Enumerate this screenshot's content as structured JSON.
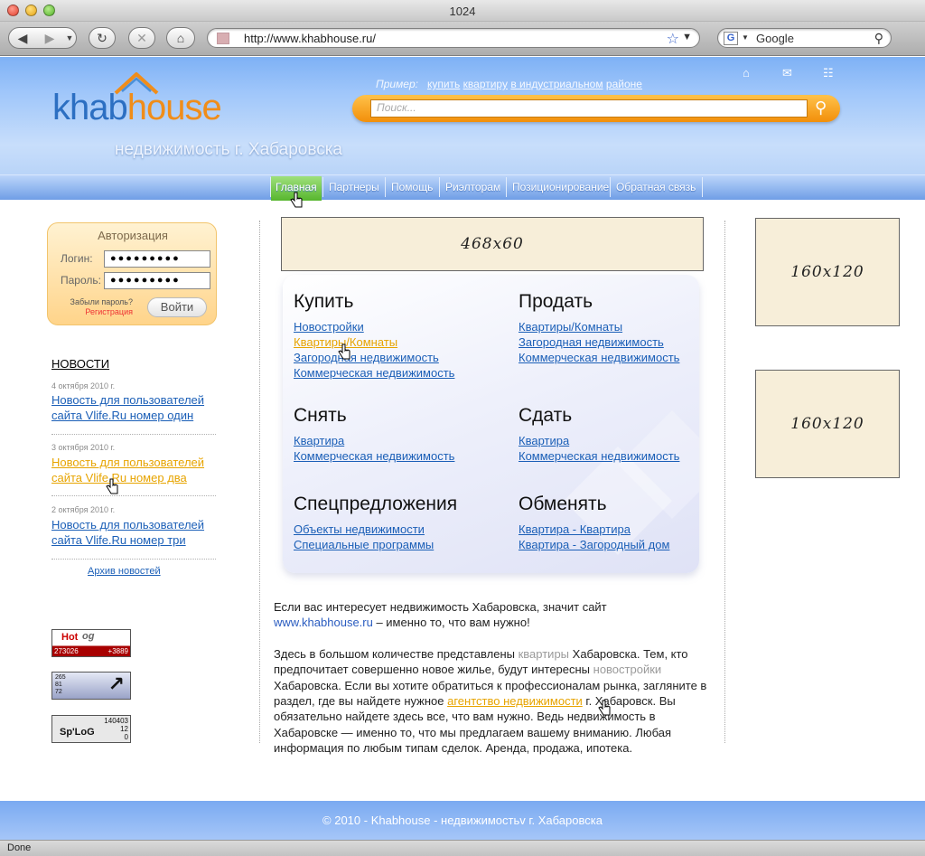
{
  "window": {
    "title": "1024"
  },
  "toolbar": {
    "url": "http://www.khabhouse.ru/",
    "search_placeholder": "Google",
    "search_engine_letter": "G"
  },
  "header": {
    "logo_part1": "khab",
    "logo_part2": "house",
    "tagline": "недвижимость г. Хабаровска",
    "example_label": "Пример:",
    "example_words": [
      "купить",
      "квартиру",
      "в индустриальном",
      "районе"
    ],
    "search_placeholder": "Поиск...",
    "icons": [
      "home-icon",
      "mail-icon",
      "sitemap-icon"
    ]
  },
  "nav": {
    "items": [
      "Главная",
      "Партнеры",
      "Помощь",
      "Риэлторам",
      "Позиционирование",
      "Обратная связь"
    ],
    "active": "Главная"
  },
  "auth": {
    "title": "Авторизация",
    "login_label": "Логин:",
    "login_value": "●●●●●●●●●",
    "password_label": "Пароль:",
    "password_value": "●●●●●●●●●",
    "forgot": "Забыли пароль?",
    "register": "Регистрация",
    "submit": "Войти"
  },
  "news": {
    "title": "НОВОСТИ",
    "items": [
      {
        "date": "4 октября 2010 г.",
        "text": "Новость для пользователей сайта Vlife.Ru номер один"
      },
      {
        "date": "3 октября 2010 г.",
        "text": "Новость для пользователей сайта Vlife.Ru номер два"
      },
      {
        "date": "2 октября 2010 г.",
        "text": "Новость для пользователей сайта Vlife.Ru номер три"
      }
    ],
    "archive": "Архив новостей"
  },
  "counters": {
    "hotlog_label": "Hot",
    "hotlog_label2": "og",
    "hotlog_left": "273026",
    "hotlog_right": "+3889",
    "c2_lines": [
      "265",
      "81",
      "72"
    ],
    "spylog_label": "Sp'LoG",
    "spylog_lines": [
      "140403",
      "12",
      "0"
    ]
  },
  "banners": {
    "top": "468x60",
    "side1": "160x120",
    "side2": "160x120"
  },
  "categories": [
    {
      "title": "Купить",
      "links": [
        "Новостройки",
        "Квартиры/Комнаты",
        "Загородная недвижимость",
        "Коммерческая недвижимость"
      ]
    },
    {
      "title": "Продать",
      "links": [
        "Квартиры/Комнаты",
        "Загородная недвижимость",
        "Коммерческая недвижимость"
      ]
    },
    {
      "title": "Снять",
      "links": [
        "Квартира",
        "Коммерческая недвижимость"
      ]
    },
    {
      "title": "Сдать",
      "links": [
        "Квартира",
        "Коммерческая недвижимость"
      ]
    },
    {
      "title": "Спецпредложения",
      "links": [
        "Объекты недвижимости",
        "Специальные программы"
      ]
    },
    {
      "title": "Обменять",
      "links": [
        "Квартира - Квартира",
        "Квартира - Загородный дом"
      ]
    }
  ],
  "intro": {
    "p1_a": "Если вас интересует недвижимость Хабаровска, значит сайт ",
    "p1_link": "www.khabhouse.ru",
    "p1_b": " – именно то, что вам нужно!",
    "p2_a": "Здесь в большом количестве представлены ",
    "p2_l1": "квартиры",
    "p2_b": " Хабаровска. Тем, кто предпочитает совершенно новое жилье, будут интересны ",
    "p2_l2": "новостройки",
    "p2_c": " Хабаровска. Если вы хотите обратиться к профессионалам рынка, загляните в раздел, где вы найдете нужное ",
    "p2_l3": "агентство недвижимости",
    "p2_d": " г. Хабаровск. Вы обязательно найдете здесь все, что вам нужно. Ведь недвижимость в Хабаровске — именно то, что мы предлагаем вашему вниманию. Любая информация по любым типам сделок. Аренда, продажа, ипотека."
  },
  "footer": {
    "text": "© 2010 - Khabhouse - недвижимостьv г. Хабаровска"
  },
  "status": {
    "text": "Done"
  },
  "colors": {
    "link": "#1b5fb7",
    "hover": "#e7a400",
    "brand_orange": "#f08d1a",
    "brand_blue": "#2c6fc2",
    "nav_active": "#57b62e"
  }
}
